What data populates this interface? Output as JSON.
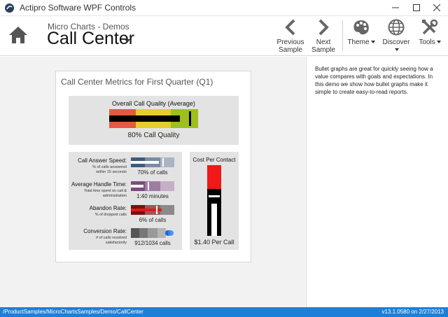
{
  "window": {
    "title": "Actipro Software WPF Controls"
  },
  "ribbon": {
    "breadcrumb_parent": "Micro Charts - Demos",
    "breadcrumb_current": "Call Center",
    "previous_line1": "Previous",
    "previous_line2": "Sample",
    "next_line1": "Next",
    "next_line2": "Sample",
    "theme_label": "Theme",
    "discover_label": "Discover",
    "tools_label": "Tools"
  },
  "card": {
    "title": "Call Center Metrics for First Quarter (Q1)",
    "overall": {
      "title": "Overall Call Quality (Average)",
      "value_text": "80% Call Quality",
      "measure_fraction": 0.8,
      "colors": [
        "#e35a3f",
        "#e6cc2e",
        "#9dc01a"
      ]
    },
    "metrics": [
      {
        "label": "Call Answer Speed:",
        "sub1": "% of calls answered",
        "sub2": "within 15 seconds",
        "value_text": "70% of calls",
        "color": "#3f5a7a"
      },
      {
        "label": "Average Handle Time:",
        "sub1": "Total time spent on call &",
        "sub2": "administration",
        "value_text": "1:40 minutes",
        "color": "#7a4c7c"
      },
      {
        "label": "Abandon Rate:",
        "sub1": "% of dropped calls",
        "sub2": "",
        "value_text": "6% of calls",
        "color": "#b01818"
      },
      {
        "label": "Conversion Rate:",
        "sub1": "# of calls resolved",
        "sub2": "satisfactorily",
        "value_text": "912/1034 calls",
        "color": "#555555"
      }
    ],
    "cost": {
      "title": "Cost Per Contact",
      "value_text": "$1.40 Per Call"
    }
  },
  "sidebar": {
    "description": "Bullet graphs are great for quickly seeing how a value compares with goals and expectations. In this demo we show how bullet graphs make it simple to create easy-to-read reports."
  },
  "status": {
    "path": "/ProductSamples/MicroChartsSamples/Demo/CallCenter",
    "version": "v13.1.0580 on 2/27/2013"
  }
}
